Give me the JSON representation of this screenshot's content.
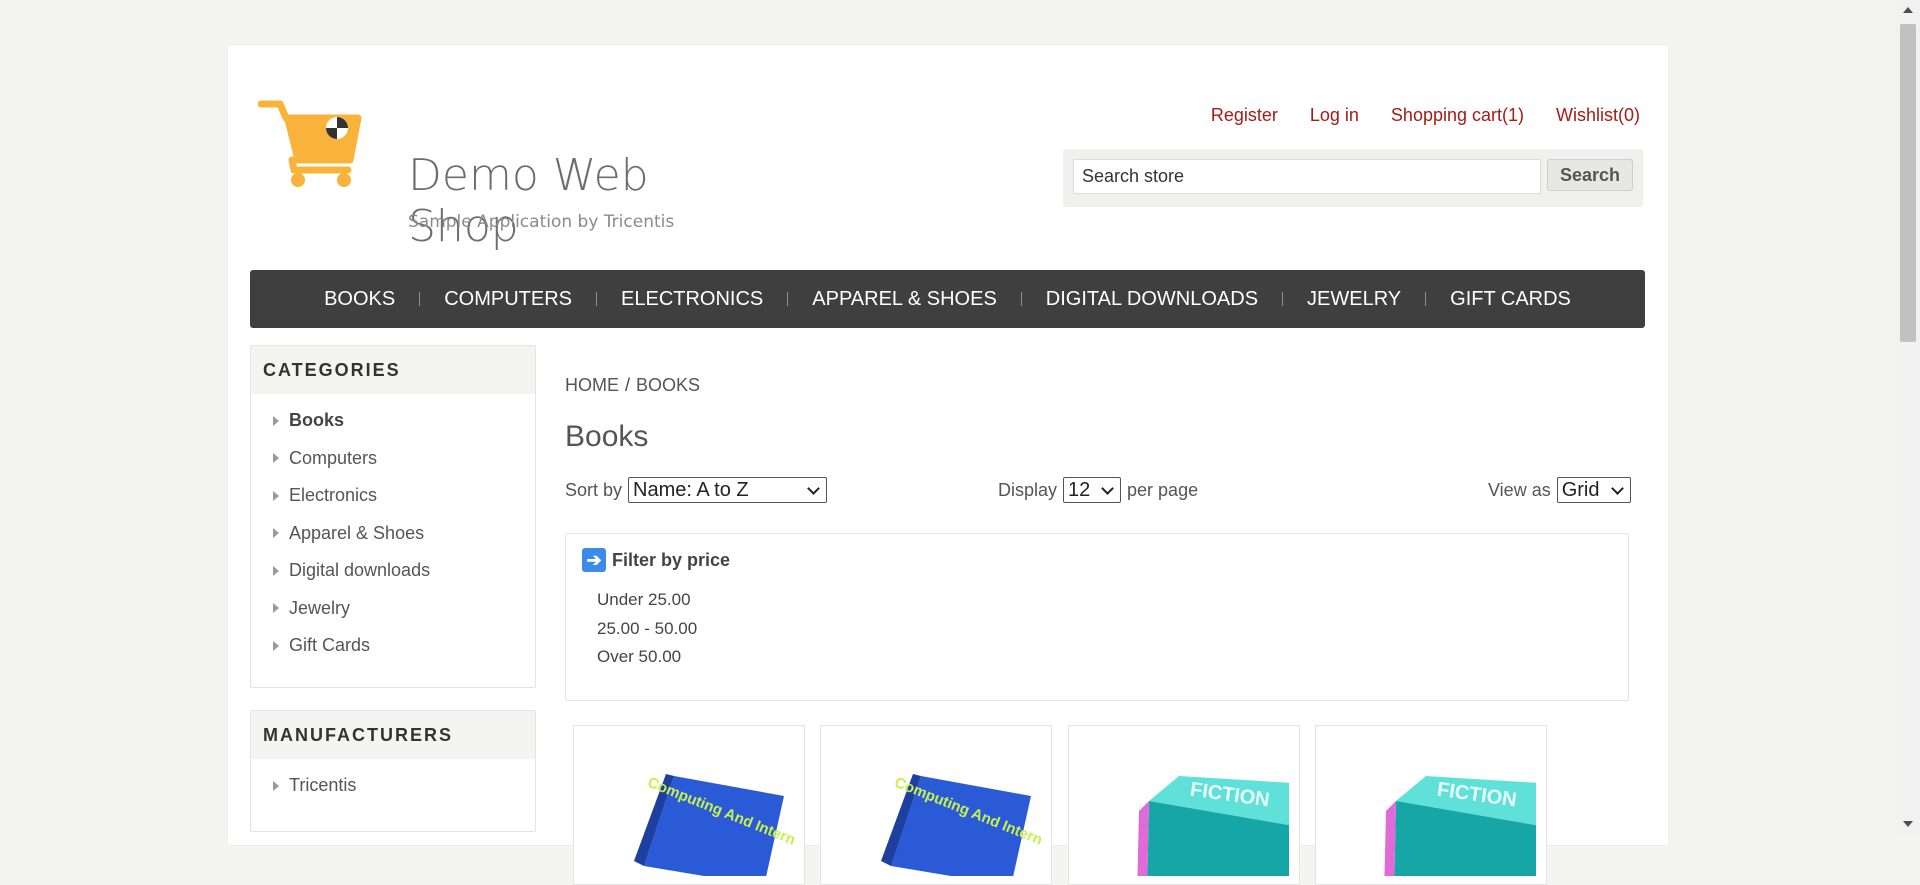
{
  "logo": {
    "title": "Demo Web Shop",
    "subtitle": "Sample Application by Tricentis",
    "icon": "shopping-cart-icon"
  },
  "header": {
    "register": "Register",
    "login": "Log in",
    "cart": "Shopping cart(1)",
    "wishlist": "Wishlist(0)"
  },
  "search": {
    "value": "Search store",
    "button": "Search"
  },
  "topnav": [
    "BOOKS",
    "COMPUTERS",
    "ELECTRONICS",
    "APPAREL & SHOES",
    "DIGITAL DOWNLOADS",
    "JEWELRY",
    "GIFT CARDS"
  ],
  "categories": {
    "title": "CATEGORIES",
    "items": [
      "Books",
      "Computers",
      "Electronics",
      "Apparel & Shoes",
      "Digital downloads",
      "Jewelry",
      "Gift Cards"
    ]
  },
  "manufacturers": {
    "title": "MANUFACTURERS",
    "items": [
      "Tricentis"
    ]
  },
  "breadcrumb": {
    "home": "HOME",
    "sep": "/",
    "current": "BOOKS"
  },
  "page_title": "Books",
  "sort": {
    "label": "Sort by",
    "value": "Name: A to Z"
  },
  "display": {
    "label": "Display",
    "value": "12",
    "suffix": "per page"
  },
  "view": {
    "label": "View as",
    "value": "Grid"
  },
  "filter": {
    "title": "Filter by price",
    "ranges": [
      "Under 25.00",
      "25.00 - 50.00",
      "Over 50.00"
    ]
  },
  "products": [
    {
      "cover_text": "Computing And Internet",
      "color": "#2a5ad6"
    },
    {
      "cover_text": "Computing And Internet",
      "color": "#2a5ad6"
    },
    {
      "cover_text": "FICTION",
      "color": "#17a6a6"
    },
    {
      "cover_text": "FICTION",
      "color": "#17a6a6"
    }
  ],
  "colors": {
    "accent_link": "#a31c17",
    "nav_bg": "#3f3f3f",
    "logo_orange": "#f9b33a"
  }
}
